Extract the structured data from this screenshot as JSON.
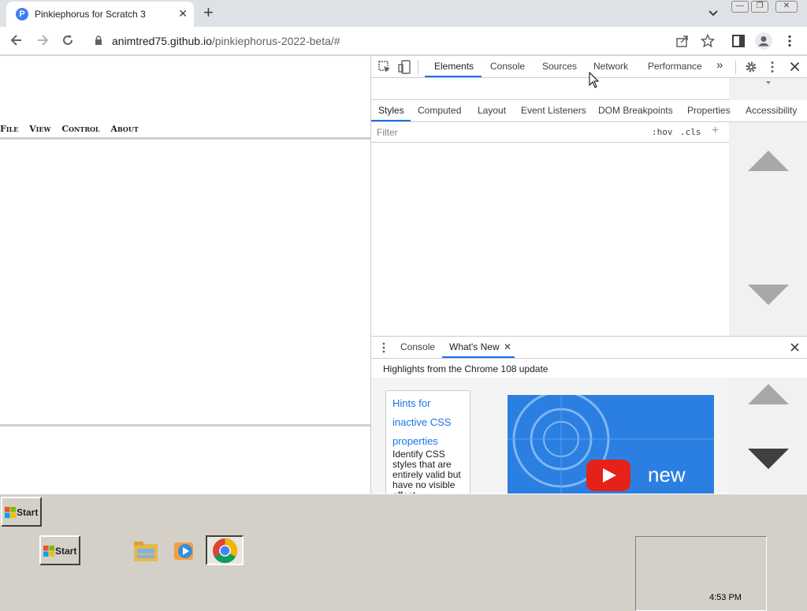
{
  "browser": {
    "tab_title": "Pinkiephorus for Scratch 3",
    "tab_close": "✕",
    "new_tab": "+",
    "url_host": "animtred75.github.io",
    "url_path": "/pinkiephorus-2022-beta/#"
  },
  "page": {
    "menu": [
      "File",
      "View",
      "Control",
      "About"
    ]
  },
  "devtools": {
    "main_tabs": [
      "Elements",
      "Console",
      "Sources",
      "Network",
      "Performance"
    ],
    "more_tabs": "»",
    "sub_tabs": [
      "Styles",
      "Computed",
      "Layout",
      "Event Listeners",
      "DOM Breakpoints",
      "Properties",
      "Accessibility"
    ],
    "filter_placeholder": "Filter",
    "hov": ":hov",
    "cls": ".cls",
    "drawer_tabs": [
      "Console",
      "What's New"
    ],
    "highlights": "Highlights from the Chrome 108 update",
    "card_title": "Hints for inactive CSS properties",
    "card_body": "Identify CSS styles that are entirely valid but have no visible effect",
    "video_text": "new"
  },
  "taskbar": {
    "start_label": "Start",
    "start_label_2": "Start",
    "clock": "4:53 PM"
  },
  "colors": {
    "accent": "#1a73e8",
    "video_bg": "#2b7fe0",
    "taskbar": "#d4d0c8"
  }
}
